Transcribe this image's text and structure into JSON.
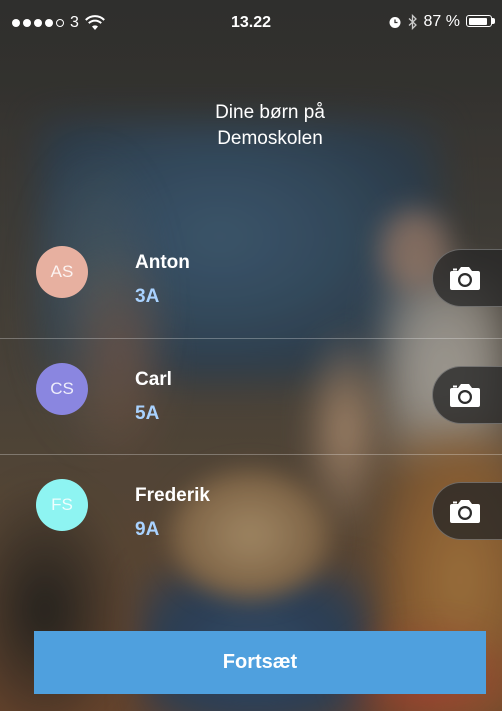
{
  "status_bar": {
    "carrier": "3",
    "signal_bars_filled": 4,
    "signal_bars_total": 5,
    "time": "13.22",
    "battery_percent_text": "87 %",
    "battery_level": 0.87,
    "icons": [
      "wifi-icon",
      "alarm-icon",
      "bluetooth-icon",
      "battery-icon"
    ]
  },
  "header": {
    "title": "Dine børn på\nDemoskolen"
  },
  "children": [
    {
      "initials": "AS",
      "name": "Anton",
      "class": "3A",
      "avatar_color": "#e7b0a0"
    },
    {
      "initials": "CS",
      "name": "Carl",
      "class": "5A",
      "avatar_color": "#8a86e0"
    },
    {
      "initials": "FS",
      "name": "Frederik",
      "class": "9A",
      "avatar_color": "#8ef4f2"
    }
  ],
  "actions": {
    "camera_icon": "camera-icon",
    "continue_label": "Fortsæt"
  },
  "colors": {
    "accent": "#4fa0de",
    "class_text": "#a9d2ff"
  }
}
